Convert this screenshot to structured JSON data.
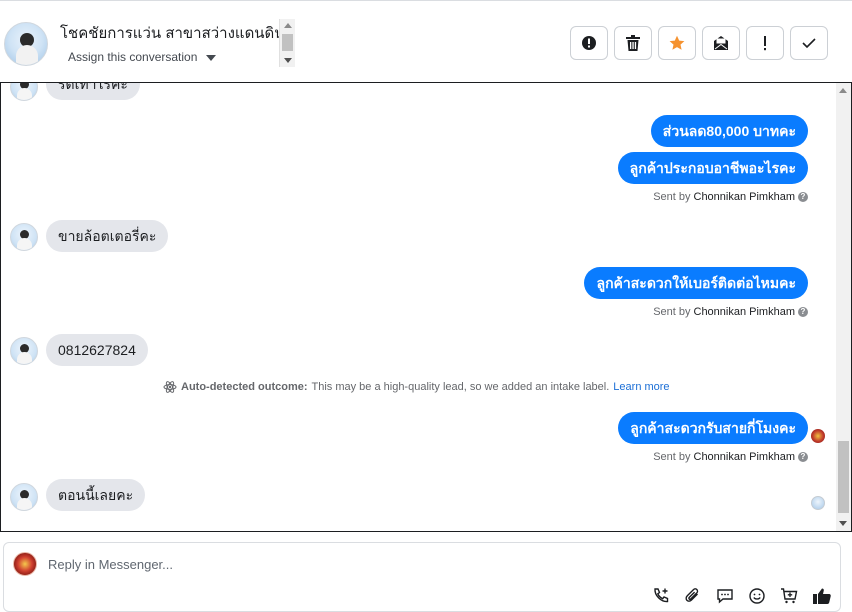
{
  "header": {
    "contact_name": "โชคชัยการแว่น สาขาสว่างแดนดิน",
    "assign_label": "Assign this conversation",
    "actions": [
      {
        "name": "mark-spam",
        "icon": "alert-circle-icon"
      },
      {
        "name": "delete",
        "icon": "trash-icon"
      },
      {
        "name": "star",
        "icon": "star-icon"
      },
      {
        "name": "mark-unread",
        "icon": "envelope-icon"
      },
      {
        "name": "follow-up",
        "icon": "exclamation-icon"
      },
      {
        "name": "mark-done",
        "icon": "check-icon"
      }
    ]
  },
  "conversation": {
    "partial_top_text": "ร้ดเท่าไรคะ",
    "messages": [
      {
        "dir": "out",
        "text": "ส่วนลด80,000 บาทคะ"
      },
      {
        "dir": "out",
        "text": "ลูกค้าประกอบอาชีพอะไรคะ"
      },
      {
        "dir": "in",
        "text": "ขายล้อตเตอรี่คะ"
      },
      {
        "dir": "out",
        "text": "ลูกค้าสะดวกให้เบอร์ติดต่อไหมคะ"
      },
      {
        "dir": "in",
        "text": "0812627824"
      },
      {
        "dir": "out",
        "text": "ลูกค้าสะดวกรับสายกี่โมงคะ"
      },
      {
        "dir": "in",
        "text": "ตอนนี้เลยคะ"
      }
    ],
    "sent_by_prefix": "Sent by",
    "sent_by_name": "Chonnikan Pimkham",
    "outcome": {
      "heading": "Auto-detected outcome:",
      "text": "This may be a high-quality lead, so we added an intake label.",
      "link": "Learn more"
    }
  },
  "composer": {
    "placeholder": "Reply in Messenger..."
  },
  "colors": {
    "outgoing_bubble": "#0a7cff",
    "incoming_bubble": "#e4e6eb",
    "star": "#f5922f"
  }
}
